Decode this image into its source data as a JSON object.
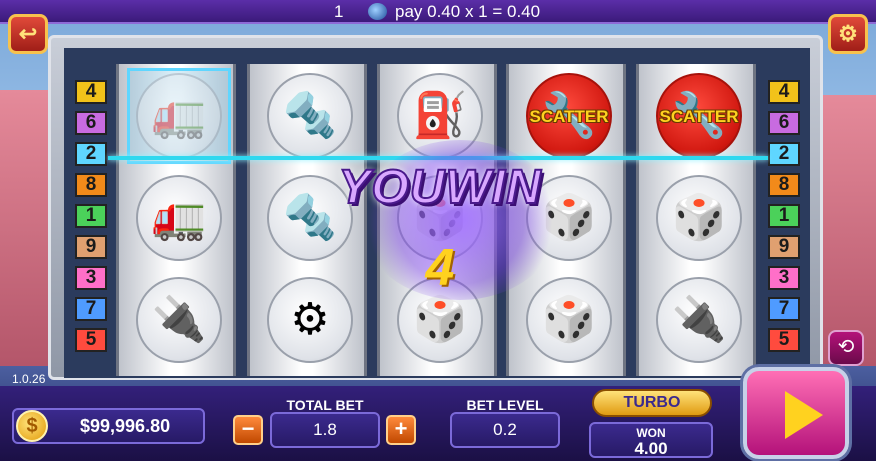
{
  "topbar": {
    "line": "1",
    "pay_text": "pay 0.40 x 1 = 0.40"
  },
  "version": "1.0.26",
  "paylines": {
    "left": [
      {
        "num": "4",
        "color": "#f2c21a"
      },
      {
        "num": "6",
        "color": "#c86be0"
      },
      {
        "num": "2",
        "color": "#5fd6ff"
      },
      {
        "num": "8",
        "color": "#f28a1a"
      },
      {
        "num": "1",
        "color": "#4bd15a"
      },
      {
        "num": "9",
        "color": "#e0a070"
      },
      {
        "num": "3",
        "color": "#ff6fc8"
      },
      {
        "num": "7",
        "color": "#4f9bff"
      },
      {
        "num": "5",
        "color": "#ff4b3e"
      }
    ],
    "right": [
      {
        "num": "4",
        "color": "#f2c21a"
      },
      {
        "num": "6",
        "color": "#c86be0"
      },
      {
        "num": "2",
        "color": "#5fd6ff"
      },
      {
        "num": "8",
        "color": "#f28a1a"
      },
      {
        "num": "1",
        "color": "#4bd15a"
      },
      {
        "num": "9",
        "color": "#e0a070"
      },
      {
        "num": "3",
        "color": "#ff6fc8"
      },
      {
        "num": "7",
        "color": "#4f9bff"
      },
      {
        "num": "5",
        "color": "#ff4b3e"
      }
    ]
  },
  "reels": [
    [
      "truck",
      "truck",
      "spark-plug"
    ],
    [
      "piston",
      "piston",
      "tire"
    ],
    [
      "fuel-can",
      "dice",
      "dice"
    ],
    [
      "scatter",
      "dice",
      "dice"
    ],
    [
      "scatter",
      "dice",
      "spark-plug"
    ]
  ],
  "scatter_label": "SCATTER",
  "win": {
    "title": "YOUWIN",
    "count": "4"
  },
  "bottom": {
    "balance": "$99,996.80",
    "total_bet_label": "TOTAL BET",
    "total_bet": "1.8",
    "bet_level_label": "BET LEVEL",
    "bet_level": "0.2",
    "turbo_label": "TURBO",
    "won_label": "WON",
    "won_value": "4.00",
    "minus": "−",
    "plus": "+"
  }
}
